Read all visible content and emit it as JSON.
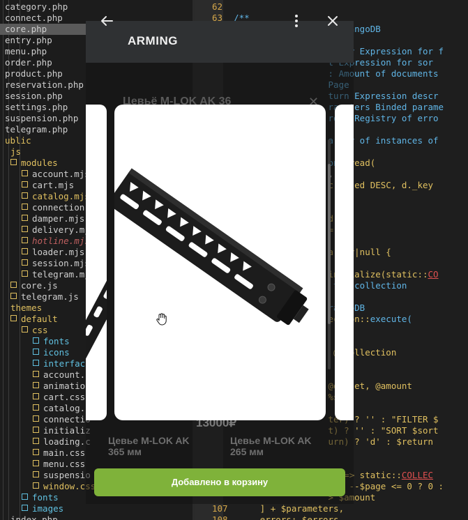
{
  "file_tree": [
    {
      "label": "category.php",
      "indent": 0,
      "type": "file",
      "color": "#cfcfcf"
    },
    {
      "label": "connect.php",
      "indent": 0,
      "type": "file",
      "color": "#cfcfcf"
    },
    {
      "label": "core.php",
      "indent": 0,
      "type": "file",
      "color": "#cfcfcf",
      "selected": true
    },
    {
      "label": "entry.php",
      "indent": 0,
      "type": "file",
      "color": "#cfcfcf"
    },
    {
      "label": "menu.php",
      "indent": 0,
      "type": "file",
      "color": "#cfcfcf"
    },
    {
      "label": "order.php",
      "indent": 0,
      "type": "file",
      "color": "#cfcfcf"
    },
    {
      "label": "product.php",
      "indent": 0,
      "type": "file",
      "color": "#cfcfcf"
    },
    {
      "label": "reservation.php",
      "indent": 0,
      "type": "file",
      "color": "#cfcfcf"
    },
    {
      "label": "session.php",
      "indent": 0,
      "type": "file",
      "color": "#cfcfcf"
    },
    {
      "label": "settings.php",
      "indent": 0,
      "type": "file",
      "color": "#cfcfcf"
    },
    {
      "label": "suspension.php",
      "indent": 0,
      "type": "file",
      "color": "#cfcfcf"
    },
    {
      "label": "telegram.php",
      "indent": 0,
      "type": "file",
      "color": "#cfcfcf"
    },
    {
      "label": "ublic",
      "indent": 0,
      "type": "dir-plain",
      "color": "#e0c060"
    },
    {
      "label": "js",
      "indent": 1,
      "type": "dir-plain",
      "color": "#e0c060"
    },
    {
      "label": "modules",
      "indent": 1,
      "type": "folder",
      "color": "#e0c060"
    },
    {
      "label": "account.mjs",
      "indent": 3,
      "type": "file-box",
      "color": "#cfcfcf"
    },
    {
      "label": "cart.mjs",
      "indent": 3,
      "type": "file-box",
      "color": "#cfcfcf"
    },
    {
      "label": "catalog.mjs",
      "indent": 3,
      "type": "file-box",
      "color": "#e0c060"
    },
    {
      "label": "connection.",
      "indent": 3,
      "type": "file-box",
      "color": "#cfcfcf"
    },
    {
      "label": "damper.mjs",
      "indent": 3,
      "type": "file-box",
      "color": "#cfcfcf"
    },
    {
      "label": "delivery.mj",
      "indent": 3,
      "type": "file-box",
      "color": "#cfcfcf"
    },
    {
      "label": "hotline.mjs",
      "indent": 3,
      "type": "file-box",
      "color": "#c06060",
      "italic": true
    },
    {
      "label": "loader.mjs",
      "indent": 3,
      "type": "file-box",
      "color": "#cfcfcf"
    },
    {
      "label": "session.mjs",
      "indent": 3,
      "type": "file-box",
      "color": "#cfcfcf"
    },
    {
      "label": "telegram.mj",
      "indent": 3,
      "type": "file-box",
      "color": "#cfcfcf"
    },
    {
      "label": "core.js",
      "indent": 1,
      "type": "file-box",
      "color": "#cfcfcf"
    },
    {
      "label": "telegram.js",
      "indent": 1,
      "type": "file-box",
      "color": "#cfcfcf"
    },
    {
      "label": "themes",
      "indent": 1,
      "type": "dir-plain",
      "color": "#e0c060"
    },
    {
      "label": "default",
      "indent": 1,
      "type": "folder",
      "color": "#e0c060"
    },
    {
      "label": "css",
      "indent": 3,
      "type": "folder",
      "color": "#e0c060"
    },
    {
      "label": "fonts",
      "indent": 5,
      "type": "folder",
      "color": "#60c0e0"
    },
    {
      "label": "icons",
      "indent": 5,
      "type": "folder",
      "color": "#60c0e0"
    },
    {
      "label": "interface",
      "indent": 5,
      "type": "folder",
      "color": "#60c0e0"
    },
    {
      "label": "account.c",
      "indent": 5,
      "type": "file-box",
      "color": "#cfcfcf"
    },
    {
      "label": "animation",
      "indent": 5,
      "type": "file-box",
      "color": "#cfcfcf"
    },
    {
      "label": "cart.css",
      "indent": 5,
      "type": "file-box",
      "color": "#cfcfcf"
    },
    {
      "label": "catalog.c",
      "indent": 5,
      "type": "file-box",
      "color": "#cfcfcf"
    },
    {
      "label": "connectio",
      "indent": 5,
      "type": "file-box",
      "color": "#cfcfcf"
    },
    {
      "label": "initializ",
      "indent": 5,
      "type": "file-box",
      "color": "#cfcfcf"
    },
    {
      "label": "loading.c",
      "indent": 5,
      "type": "file-box",
      "color": "#cfcfcf"
    },
    {
      "label": "main.css",
      "indent": 5,
      "type": "file-box",
      "color": "#cfcfcf"
    },
    {
      "label": "menu.css",
      "indent": 5,
      "type": "file-box",
      "color": "#cfcfcf"
    },
    {
      "label": "suspensio",
      "indent": 5,
      "type": "file-box",
      "color": "#cfcfcf"
    },
    {
      "label": "window.css",
      "indent": 5,
      "type": "file-box",
      "color": "#e0c060"
    },
    {
      "label": "fonts",
      "indent": 3,
      "type": "folder",
      "color": "#60c0e0"
    },
    {
      "label": "images",
      "indent": 3,
      "type": "folder",
      "color": "#60c0e0"
    },
    {
      "label": "index.php",
      "indent": 1,
      "type": "file",
      "color": "#cfcfcf"
    }
  ],
  "code_lines": [
    {
      "ln": "62",
      "parts": []
    },
    {
      "ln": "63",
      "parts": [
        {
          "t": "  /**",
          "c": "t-blue"
        }
      ]
    },
    {
      "ln": "",
      "parts": [
        {
          "t": "                    m ArangoDB",
          "c": "t-blue"
        }
      ]
    },
    {
      "ln": "",
      "parts": []
    },
    {
      "ln": "",
      "parts": [
        {
          "t": "                    ilter Expression for f",
          "c": "t-blue"
        }
      ]
    },
    {
      "ln": "",
      "parts": [
        {
          "t": "                    t Expression for sor",
          "c": "t-blue"
        }
      ]
    },
    {
      "ln": "",
      "parts": [
        {
          "t": "                    : Amount of documents",
          "c": "t-blue"
        }
      ]
    },
    {
      "ln": "",
      "parts": [
        {
          "t": "                    Page",
          "c": "t-blue"
        }
      ]
    },
    {
      "ln": "",
      "parts": [
        {
          "t": "                    turn Expression descr",
          "c": "t-blue"
        }
      ]
    },
    {
      "ln": "",
      "parts": [
        {
          "t": "                    rameters Binded parame",
          "c": "t-blue"
        }
      ]
    },
    {
      "ln": "",
      "parts": [
        {
          "t": "                    rors Registry of erro",
          "c": "t-blue"
        }
      ]
    },
    {
      "ln": "",
      "parts": []
    },
    {
      "ln": "",
      "parts": [
        {
          "t": "                    array of instances of",
          "c": "t-blue"
        }
      ]
    },
    {
      "ln": "",
      "parts": []
    },
    {
      "ln": "",
      "parts": [
        {
          "t": "                    on ",
          "c": "t-blue"
        },
        {
          "t": "_read(",
          "c": "t-yel"
        }
      ]
    },
    {
      "ln": "",
      "parts": [
        {
          "t": "                    ,",
          "c": "tx"
        }
      ]
    },
    {
      "ln": "",
      "parts": [
        {
          "t": "                    created DESC, d._key",
          "c": "t-yel"
        }
      ]
    },
    {
      "ln": "",
      "parts": []
    },
    {
      "ln": "",
      "parts": []
    },
    {
      "ln": "",
      "parts": [
        {
          "t": "                    d',",
          "c": "t-yel"
        }
      ]
    },
    {
      "ln": "",
      "parts": [
        {
          "t": "                    = [],",
          "c": "t-yel"
        }
      ]
    },
    {
      "ln": "",
      "parts": []
    },
    {
      "ln": "",
      "parts": [
        {
          "t": "                    array|null {",
          "c": "t-yel"
        }
      ]
    },
    {
      "ln": "",
      "parts": []
    },
    {
      "ln": "",
      "parts": [
        {
          "t": "                    initialize(static::",
          "c": "t-yel"
        },
        {
          "t": "CO",
          "c": "t-red"
        }
      ]
    },
    {
      "ln": "",
      "parts": [
        {
          "t": "                     the collection",
          "c": "t-blue"
        }
      ]
    },
    {
      "ln": "",
      "parts": []
    },
    {
      "ln": "",
      "parts": [
        {
          "t": "                    rangoDB",
          "c": "t-blue"
        }
      ]
    },
    {
      "ln": "",
      "parts": [
        {
          "t": "                    ection::",
          "c": "t-yel"
        },
        {
          "t": "execute(",
          "c": "t-blue"
        }
      ]
    },
    {
      "ln": "",
      "parts": []
    },
    {
      "ln": "",
      "parts": []
    },
    {
      "ln": "",
      "parts": [
        {
          "t": "                     @@collection",
          "c": "t-yel"
        }
      ]
    },
    {
      "ln": "",
      "parts": []
    },
    {
      "ln": "",
      "parts": []
    },
    {
      "ln": "",
      "parts": [
        {
          "t": "                    @offset, @amount",
          "c": "t-yel"
        }
      ]
    },
    {
      "ln": "",
      "parts": [
        {
          "t": "                    %s",
          "c": "t-yel"
        }
      ]
    },
    {
      "ln": "",
      "parts": []
    },
    {
      "ln": "",
      "parts": [
        {
          "t": "                    ter) ? '' : \"FILTER $",
          "c": "t-yel"
        }
      ]
    },
    {
      "ln": "",
      "parts": [
        {
          "t": "                    t) ? '' : \"SORT $sort",
          "c": "t-yel"
        }
      ]
    },
    {
      "ln": "",
      "parts": [
        {
          "t": "                    urn) ? 'd' : $return",
          "c": "t-yel"
        }
      ]
    },
    {
      "ln": "",
      "parts": []
    },
    {
      "ln": "",
      "parts": []
    },
    {
      "ln": "",
      "parts": [
        {
          "t": "                    n' => static::",
          "c": "t-yel"
        },
        {
          "t": "COLLEC",
          "c": "t-red"
        }
      ]
    },
    {
      "ln": "",
      "parts": [
        {
          "t": "                     => --$page <= 0 ? 0 :",
          "c": "t-yel"
        }
      ]
    },
    {
      "ln": "",
      "parts": [
        {
          "t": "                    > $amount",
          "c": "t-yel"
        }
      ]
    },
    {
      "ln": "107",
      "parts": [
        {
          "t": "       ] + $parameters,",
          "c": "t-yel"
        }
      ]
    },
    {
      "ln": "108",
      "parts": [
        {
          "t": "       errors: $errors",
          "c": "t-yel"
        }
      ]
    }
  ],
  "dialog": {
    "title": "ARMING",
    "back_icon": "arrow-left-icon",
    "menu_icon": "kebab-menu-icon",
    "close_icon": "close-icon",
    "background_product_title": "Цевьё M-LOK AK 36",
    "background_price": "13000₽",
    "background_items": [
      {
        "name": "Цевье M-LOK AK",
        "size": "365 мм"
      },
      {
        "name": "Цевье M-LOK AK",
        "size": "265 мм"
      }
    ],
    "add_to_cart_label": "Добавлено в корзину",
    "accent_color": "#7fb23a"
  }
}
